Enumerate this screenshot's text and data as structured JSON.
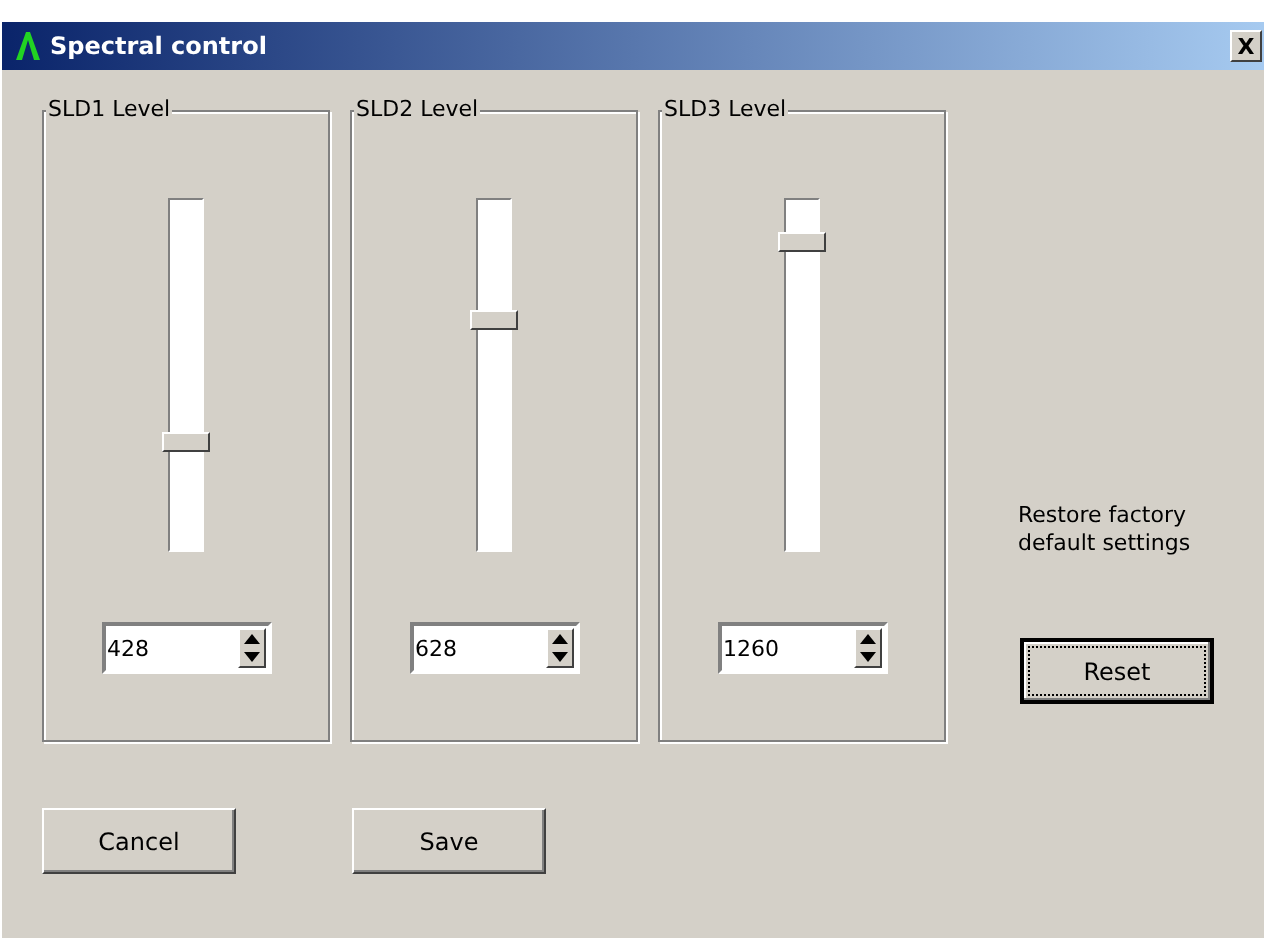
{
  "window": {
    "title": "Spectral control",
    "close": "X"
  },
  "groups": [
    {
      "label": "SLD1 Level",
      "level": 0.31,
      "value": "428"
    },
    {
      "label": "SLD2 Level",
      "level": 0.66,
      "value": "628"
    },
    {
      "label": "SLD3 Level",
      "level": 0.88,
      "value": "1260"
    }
  ],
  "restore_text": "Restore factory default settings",
  "buttons": [
    {
      "label": "Cancel",
      "focused": false
    },
    {
      "label": "Save",
      "focused": false
    }
  ],
  "reset_button": {
    "label": "Reset",
    "focused": true
  }
}
